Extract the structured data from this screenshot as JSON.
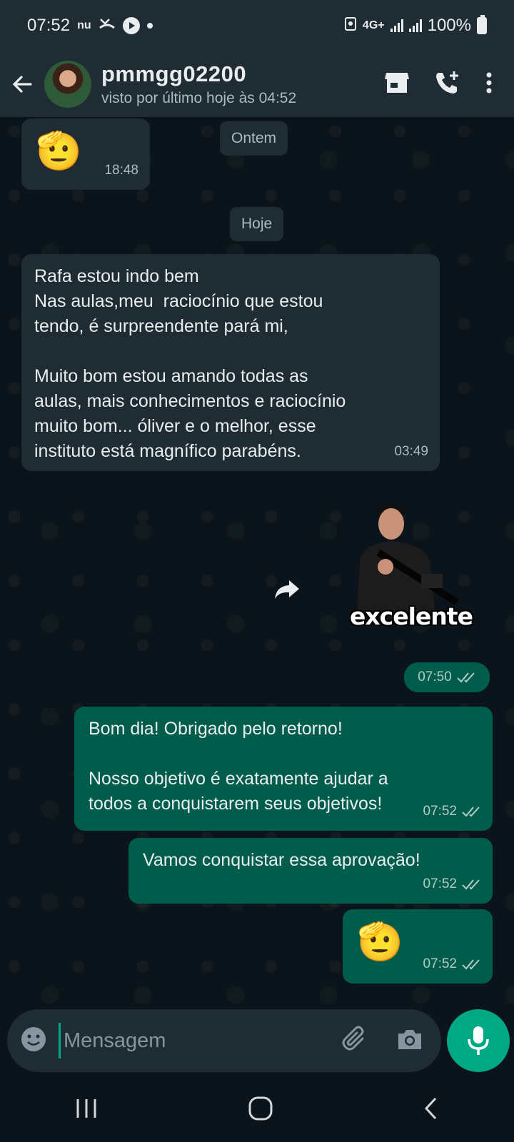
{
  "status_bar": {
    "time": "07:52",
    "carrier_glyph": "nu",
    "network": "4G+",
    "battery": "100%"
  },
  "header": {
    "contact_name": "pmmgg02200",
    "last_seen": "visto por último hoje às 04:52"
  },
  "chat": {
    "messages": [
      {
        "direction": "in",
        "emoji": "🫡",
        "time": "18:48"
      },
      {
        "type": "date",
        "text": "Ontem"
      },
      {
        "type": "date",
        "text": "Hoje"
      },
      {
        "direction": "in",
        "lines": [
          "Rafa estou indo bem",
          "Nas aulas,meu  raciocínio que estou",
          "tendo, é surpreendente pará mi,",
          "",
          "Muito bom estou amando todas as",
          "aulas, mais conhecimentos e raciocínio",
          "muito bom... óliver e o melhor, esse",
          "instituto está magnífico parabéns."
        ],
        "time": "03:49"
      },
      {
        "direction": "out",
        "type": "sticker",
        "sticker_text": "excelente",
        "time": "07:50"
      },
      {
        "direction": "out",
        "lines": [
          "Bom dia! Obrigado pelo retorno!",
          "",
          "Nosso objetivo é exatamente ajudar a",
          "todos a conquistarem seus objetivos!"
        ],
        "time": "07:52"
      },
      {
        "direction": "out",
        "lines": [
          "Vamos conquistar essa aprovação!"
        ],
        "time": "07:52"
      },
      {
        "direction": "out",
        "emoji": "🫡",
        "time": "07:52"
      }
    ]
  },
  "input": {
    "placeholder": "Mensagem"
  },
  "icons": {
    "back": "arrow-left-icon",
    "store": "store-icon",
    "call_add": "add-call-icon",
    "menu": "more-vert-icon",
    "emoji": "emoji-icon",
    "attach": "paperclip-icon",
    "camera": "camera-icon",
    "mic": "microphone-icon",
    "forward": "forward-icon"
  },
  "colors": {
    "incoming_bubble": "#1f2c34",
    "outgoing_bubble": "#005c4b",
    "accent": "#00a884",
    "background": "#0b141a"
  }
}
